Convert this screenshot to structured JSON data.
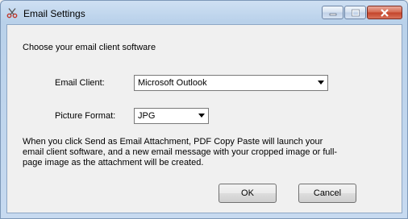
{
  "window": {
    "title": "Email Settings"
  },
  "main": {
    "heading": "Choose your email client software",
    "email_client_label": "Email Client:",
    "email_client_value": "Microsoft Outlook",
    "picture_format_label": "Picture Format:",
    "picture_format_value": "JPG",
    "description": "When you click Send as Email Attachment, PDF Copy Paste will launch your email client software, and a new email message with your cropped image or full-page image as the attachment will be created.",
    "ok_label": "OK",
    "cancel_label": "Cancel"
  },
  "icons": {
    "app": "scissors-icon",
    "minimize": "minimize-icon",
    "maximize": "maximize-icon",
    "close": "close-icon",
    "dropdown": "chevron-down-icon"
  }
}
